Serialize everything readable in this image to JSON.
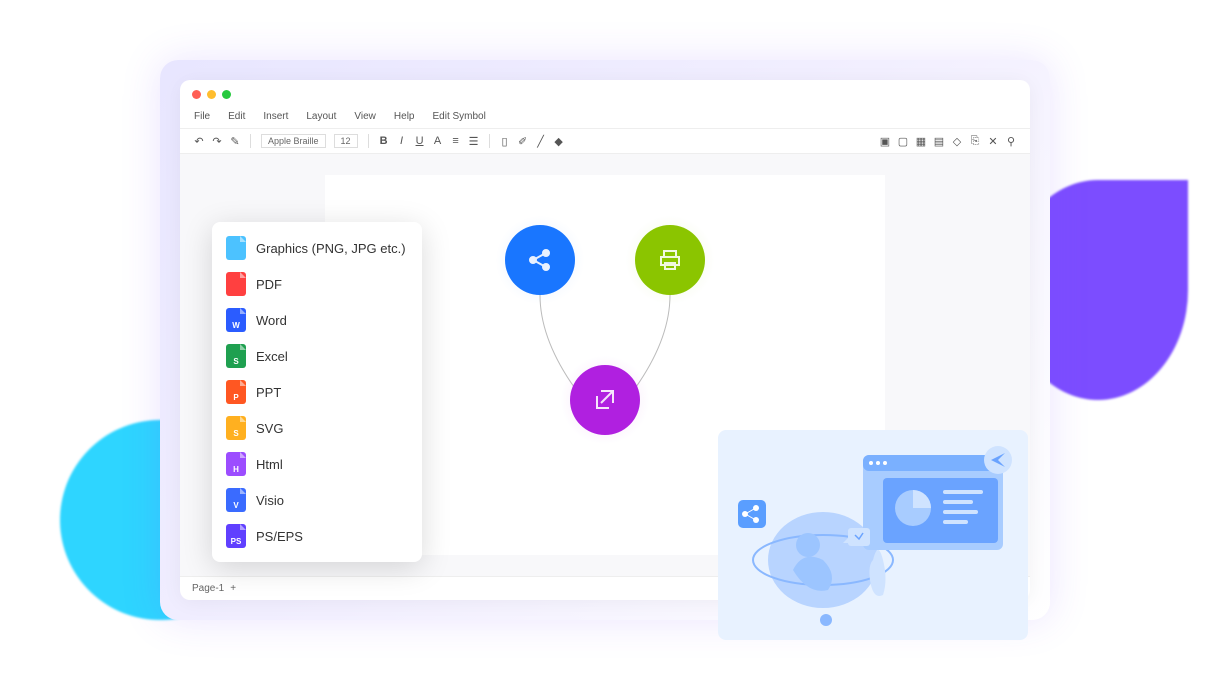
{
  "menu": [
    "File",
    "Edit",
    "Insert",
    "Layout",
    "View",
    "Help",
    "Edit Symbol"
  ],
  "font": {
    "name": "Apple Braille",
    "size": "12"
  },
  "page": "Page-1",
  "export": [
    {
      "label": "Graphics (PNG, JPG etc.)",
      "color": "#4cc2ff",
      "t": ""
    },
    {
      "label": "PDF",
      "color": "#ff4040",
      "t": ""
    },
    {
      "label": "Word",
      "color": "#2b5cff",
      "t": "W"
    },
    {
      "label": "Excel",
      "color": "#1fa050",
      "t": "S"
    },
    {
      "label": "PPT",
      "color": "#ff5722",
      "t": "P"
    },
    {
      "label": "SVG",
      "color": "#ffb020",
      "t": "S"
    },
    {
      "label": "Html",
      "color": "#9c4dff",
      "t": "H"
    },
    {
      "label": "Visio",
      "color": "#3a6bff",
      "t": "V"
    },
    {
      "label": "PS/EPS",
      "color": "#6040ff",
      "t": "PS"
    }
  ],
  "nodes": {
    "share": "share-icon",
    "print": "print-icon",
    "open": "open-external-icon"
  }
}
